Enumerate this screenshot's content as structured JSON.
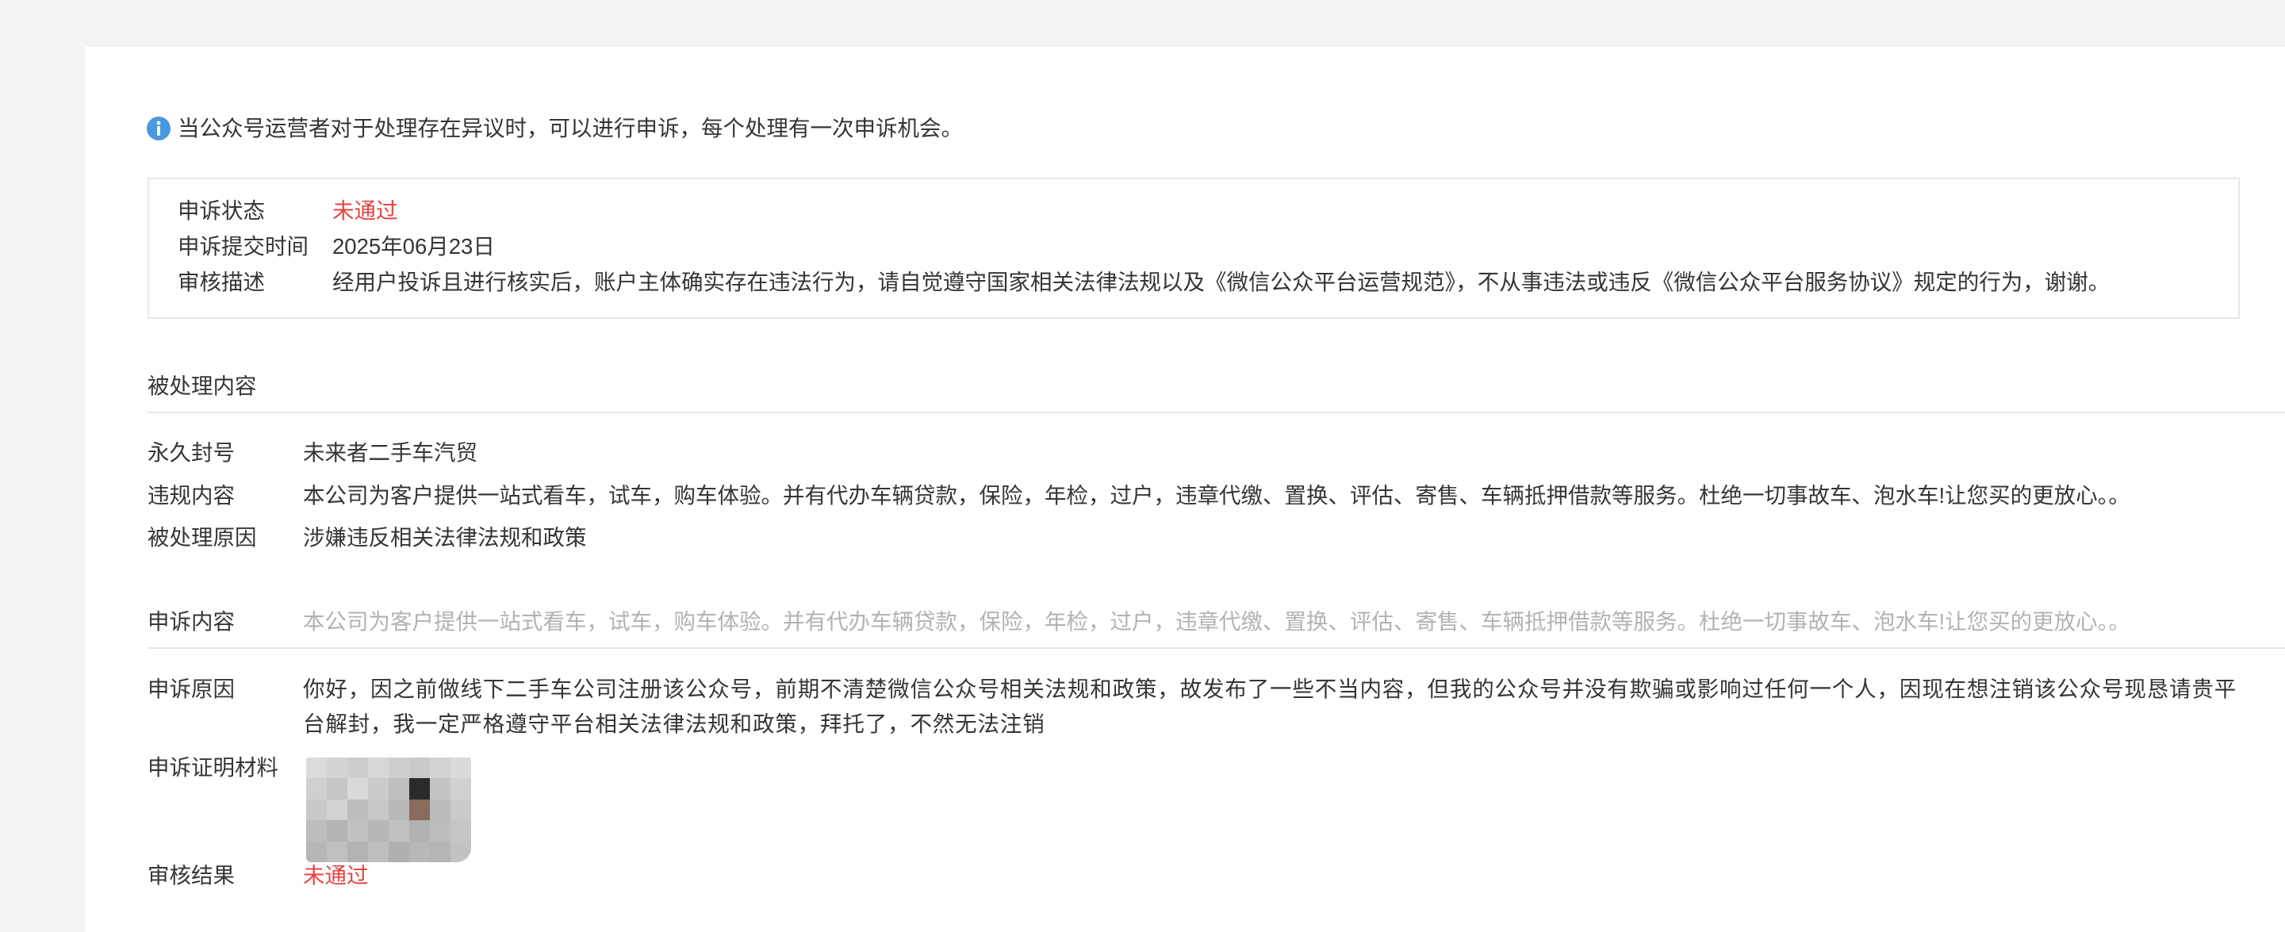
{
  "notice": {
    "icon": "info-icon",
    "text": "当公众号运营者对于处理存在异议时，可以进行申诉，每个处理有一次申诉机会。"
  },
  "appeal_summary": {
    "status_label": "申诉状态",
    "status_value": "未通过",
    "submit_time_label": "申诉提交时间",
    "submit_time_value": "2025年06月23日",
    "review_desc_label": "审核描述",
    "review_desc_value": "经用户投诉且进行核实后，账户主体确实存在违法行为，请自觉遵守国家相关法律法规以及《微信公众平台运营规范》，不从事违法或违反《微信公众平台服务协议》规定的行为，谢谢。"
  },
  "processed_content": {
    "section_title": "被处理内容",
    "penalty_label": "永久封号",
    "penalty_value": "未来者二手车汽贸",
    "violation_label": "违规内容",
    "violation_value": "本公司为客户提供一站式看车，试车，购车体验。并有代办车辆贷款，保险，年检，过户，违章代缴、置换、评估、寄售、车辆抵押借款等服务。杜绝一切事故车、泡水车!让您买的更放心。。",
    "reason_label": "被处理原因",
    "reason_value": "涉嫌违反相关法律法规和政策"
  },
  "appeal_detail": {
    "content_label": "申诉内容",
    "content_value": "本公司为客户提供一站式看车，试车，购车体验。并有代办车辆贷款，保险，年检，过户，违章代缴、置换、评估、寄售、车辆抵押借款等服务。杜绝一切事故车、泡水车!让您买的更放心。。",
    "reason_label": "申诉原因",
    "reason_value": "你好，因之前做线下二手车公司注册该公众号，前期不清楚微信公众号相关法规和政策，故发布了一些不当内容，但我的公众号并没有欺骗或影响过任何一个人，因现在想注销该公众号现恳请贵平台解封，我一定严格遵守平台相关法律法规和政策，拜托了，不然无法注销",
    "evidence_label": "申诉证明材料",
    "result_label": "审核结果",
    "result_value": "未通过"
  },
  "colors": {
    "text": "#353535",
    "muted_text": "#b2b2b2",
    "status_red": "#e64340",
    "info_blue": "#4a98e0",
    "border": "#e7e7eb",
    "page_background": "#f2f3f5",
    "panel_background": "#ffffff"
  }
}
